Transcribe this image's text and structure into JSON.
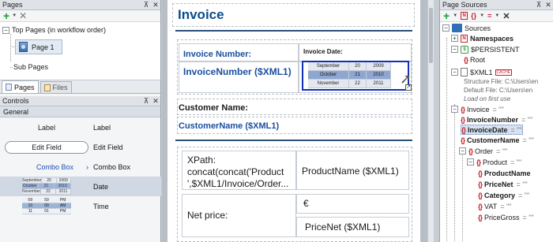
{
  "pages_panel": {
    "title": "Pages",
    "top_pages": "Top Pages (in workflow order)",
    "page1": "Page 1",
    "sub_pages": "Sub Pages",
    "tab_pages": "Pages",
    "tab_files": "Files"
  },
  "controls_panel": {
    "title": "Controls",
    "group": "General",
    "items": [
      {
        "preview": "Label",
        "name": "Label"
      },
      {
        "preview": "Edit Field",
        "name": "Edit Field"
      },
      {
        "preview": "Combo Box",
        "name": "Combo Box"
      },
      {
        "preview": "",
        "name": "Date"
      },
      {
        "preview": "",
        "name": "Time"
      }
    ],
    "date_preview": [
      [
        "September",
        "20",
        "2009"
      ],
      [
        "October",
        "21",
        "2010"
      ],
      [
        "November",
        "22",
        "2011"
      ]
    ],
    "time_preview": [
      [
        "09",
        "59",
        "PM"
      ],
      [
        "10",
        "00",
        "AM"
      ],
      [
        "11",
        "01",
        "PM"
      ]
    ]
  },
  "design": {
    "title": "Invoice",
    "invoice_number_label": "Invoice Number:",
    "invoice_date_label": "Invoice Date:",
    "invoice_number_value": "InvoiceNumber ($XML1)",
    "date_rows": [
      [
        "September",
        "20",
        "2009"
      ],
      [
        "October",
        "21",
        "2010"
      ],
      [
        "November",
        "22",
        "2011"
      ]
    ],
    "customer_name_label": "Customer Name:",
    "customer_name_value": "CustomerName ($XML1)",
    "xpath_text": "XPath: concat(concat('Product ',$XML1/Invoice/Order...",
    "product_name_value": "ProductName ($XML1)",
    "net_price_label": "Net price:",
    "euro_symbol": "€",
    "price_net_value": "PriceNet ($XML1)"
  },
  "sources_panel": {
    "title": "Page Sources",
    "root": "Sources",
    "namespaces": "Namespaces",
    "persistent": "$PERSISTENT",
    "root_el": "Root",
    "xml1": "$XML1",
    "cache_badge": "CACHE",
    "structure_file": "Structure File: C:\\Users\\en",
    "default_file": "Default File: C:\\Users\\en",
    "load_first": "Load on first use",
    "elements": [
      {
        "name": "Invoice",
        "eq": "= \"\"",
        "bold": false
      },
      {
        "name": "InvoiceNumber",
        "eq": "= \"\"",
        "bold": true
      },
      {
        "name": "InvoiceDate",
        "eq": "= \"\"",
        "bold": true
      },
      {
        "name": "CustomerName",
        "eq": "= \"\"",
        "bold": true
      },
      {
        "name": "Order",
        "eq": "= \"\"",
        "bold": false
      },
      {
        "name": "Product",
        "eq": "= \"\"",
        "bold": false
      },
      {
        "name": "ProductName",
        "eq": "",
        "bold": true
      },
      {
        "name": "PriceNet",
        "eq": "= \"\"",
        "bold": true
      },
      {
        "name": "Category",
        "eq": "= \"\"",
        "bold": true
      },
      {
        "name": "VAT",
        "eq": "= \"\"",
        "bold": false
      },
      {
        "name": "PriceGross",
        "eq": "= \"\"",
        "bold": false
      }
    ]
  }
}
